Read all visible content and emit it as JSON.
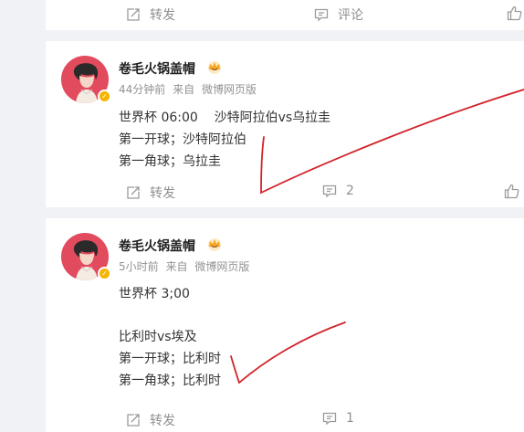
{
  "top_actions": {
    "repost": "转发",
    "comment": "评论"
  },
  "posts": [
    {
      "author": "卷毛火锅盖帽",
      "time": "44分钟前",
      "source_prefix": "来自",
      "source": "微博网页版",
      "lines": [
        "世界杯 06:00    沙特阿拉伯vs乌拉圭",
        "第一开球；沙特阿拉伯",
        "第一角球；乌拉圭"
      ],
      "repost": "转发",
      "comment_count": "2"
    },
    {
      "author": "卷毛火锅盖帽",
      "time": "5小时前",
      "source_prefix": "来自",
      "source": "微博网页版",
      "lines": [
        "世界杯 3;00",
        "",
        "比利时vs埃及",
        "第一开球；比利时",
        "第一角球；比利时"
      ],
      "repost": "转发",
      "comment_count": "1"
    }
  ],
  "colors": {
    "background": "#f1f2f5",
    "card": "#ffffff",
    "annotation_red": "#d2232a",
    "avatar_bg": "#e24a5e",
    "verified_badge": "#f5b400"
  },
  "icons": [
    "repost-icon",
    "comment-icon",
    "like-icon",
    "crown-icon",
    "verified-icon"
  ]
}
